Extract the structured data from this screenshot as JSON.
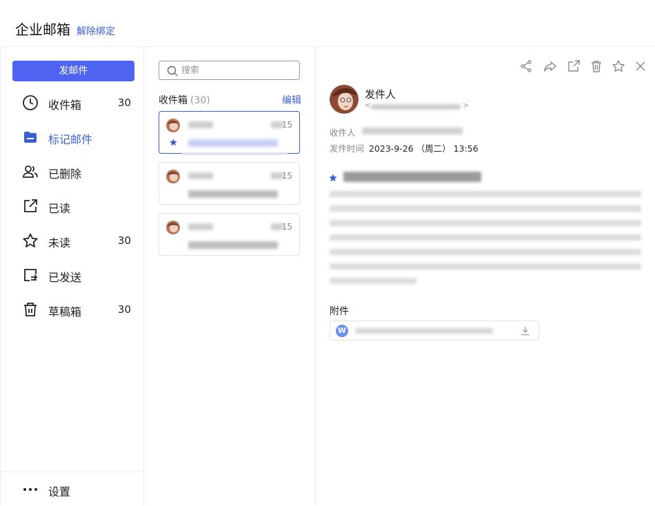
{
  "header": {
    "title": "企业邮箱",
    "unbind_label": "解除绑定"
  },
  "sidebar": {
    "compose_label": "发邮件",
    "items": [
      {
        "label": "收件箱",
        "count": "30",
        "icon": "clock-icon"
      },
      {
        "label": "标记邮件",
        "count": "",
        "icon": "folder-icon"
      },
      {
        "label": "已删除",
        "count": "",
        "icon": "users-icon"
      },
      {
        "label": "已读",
        "count": "",
        "icon": "external-link-icon"
      },
      {
        "label": "未读",
        "count": "30",
        "icon": "star-icon"
      },
      {
        "label": "已发送",
        "count": "",
        "icon": "sent-icon"
      },
      {
        "label": "草稿箱",
        "count": "30",
        "icon": "trash-icon"
      }
    ],
    "settings_label": "设置"
  },
  "list": {
    "search_placeholder": "搜索",
    "heading": "收件箱",
    "heading_count": "(30)",
    "edit_label": "编辑",
    "mails": [
      {
        "time": "15",
        "starred": true,
        "selected": true
      },
      {
        "time": "15",
        "starred": false,
        "selected": false
      },
      {
        "time": "15",
        "starred": false,
        "selected": false
      }
    ]
  },
  "detail": {
    "toolbar": [
      "share-icon",
      "forward-icon",
      "open-external-icon",
      "delete-icon",
      "star-icon",
      "close-icon"
    ],
    "sender_name": "发件人",
    "recipient_label": "收件人",
    "sent_time_label": "发件时间",
    "sent_time": "2023-9-26 （周二） 13:56",
    "attachments_label": "附件"
  },
  "colors": {
    "accent": "#3c5fd6",
    "compose_bg": "#4e63f0"
  }
}
